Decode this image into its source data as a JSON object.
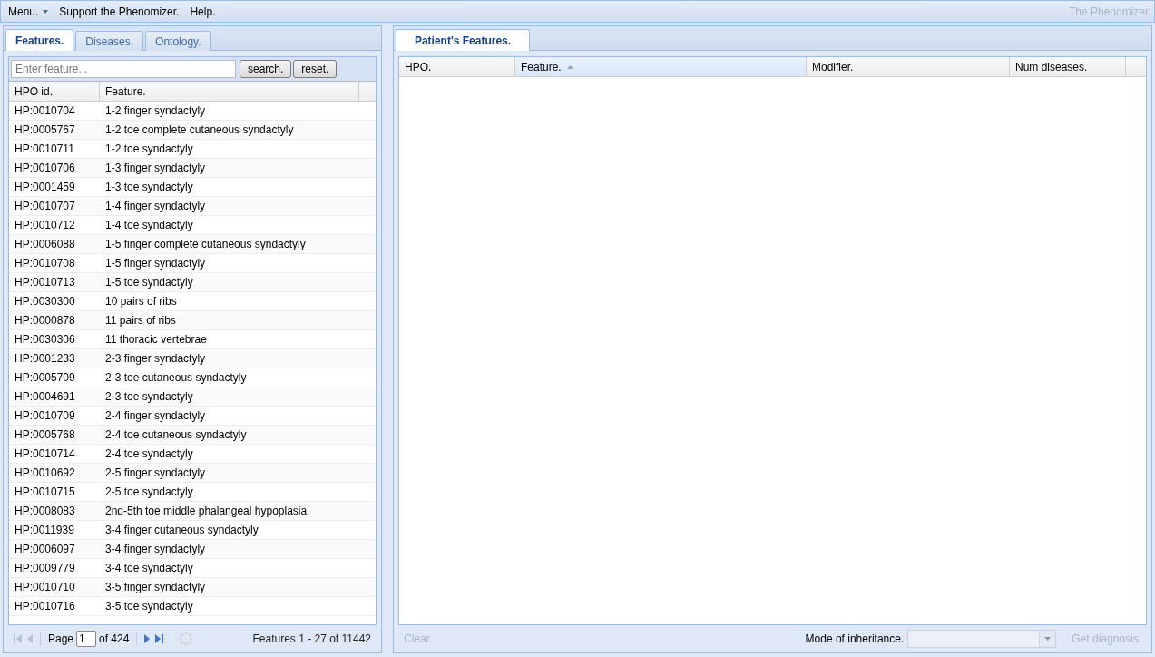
{
  "menu_bar": {
    "items": [
      {
        "label": "Menu.",
        "has_dropdown": true
      },
      {
        "label": "Support the Phenomizer.",
        "has_dropdown": false
      },
      {
        "label": "Help.",
        "has_dropdown": false
      }
    ],
    "app_title": "The Phenomizer"
  },
  "left_panel": {
    "tabs": [
      {
        "label": "Features.",
        "selected": true
      },
      {
        "label": "Diseases.",
        "selected": false
      },
      {
        "label": "Ontology.",
        "selected": false
      }
    ],
    "search": {
      "placeholder": "Enter feature...",
      "buttons": [
        "search.",
        "reset."
      ]
    },
    "table": {
      "columns": [
        {
          "label": "HPO id."
        },
        {
          "label": "Feature."
        }
      ],
      "rows": [
        [
          "HP:0010704",
          "1-2 finger syndactyly"
        ],
        [
          "HP:0005767",
          "1-2 toe complete cutaneous syndactyly"
        ],
        [
          "HP:0010711",
          "1-2 toe syndactyly"
        ],
        [
          "HP:0010706",
          "1-3 finger syndactyly"
        ],
        [
          "HP:0001459",
          "1-3 toe syndactyly"
        ],
        [
          "HP:0010707",
          "1-4 finger syndactyly"
        ],
        [
          "HP:0010712",
          "1-4 toe syndactyly"
        ],
        [
          "HP:0006088",
          "1-5 finger complete cutaneous syndactyly"
        ],
        [
          "HP:0010708",
          "1-5 finger syndactyly"
        ],
        [
          "HP:0010713",
          "1-5 toe syndactyly"
        ],
        [
          "HP:0030300",
          "10 pairs of ribs"
        ],
        [
          "HP:0000878",
          "11 pairs of ribs"
        ],
        [
          "HP:0030306",
          "11 thoracic vertebrae"
        ],
        [
          "HP:0001233",
          "2-3 finger syndactyly"
        ],
        [
          "HP:0005709",
          "2-3 toe cutaneous syndactyly"
        ],
        [
          "HP:0004691",
          "2-3 toe syndactyly"
        ],
        [
          "HP:0010709",
          "2-4 finger syndactyly"
        ],
        [
          "HP:0005768",
          "2-4 toe cutaneous syndactyly"
        ],
        [
          "HP:0010714",
          "2-4 toe syndactyly"
        ],
        [
          "HP:0010692",
          "2-5 finger syndactyly"
        ],
        [
          "HP:0010715",
          "2-5 toe syndactyly"
        ],
        [
          "HP:0008083",
          "2nd-5th toe middle phalangeal hypoplasia"
        ],
        [
          "HP:0011939",
          "3-4 finger cutaneous syndactyly"
        ],
        [
          "HP:0006097",
          "3-4 finger syndactyly"
        ],
        [
          "HP:0009779",
          "3-4 toe syndactyly"
        ],
        [
          "HP:0010710",
          "3-5 finger syndactyly"
        ],
        [
          "HP:0010716",
          "3-5 toe syndactyly"
        ]
      ]
    },
    "pager": {
      "first_disabled": true,
      "prev_disabled": true,
      "next_disabled": false,
      "last_disabled": false,
      "page_label": "Page",
      "page_value": "1",
      "page_total": "of 424",
      "summary": "Features 1 - 27 of 11442"
    }
  },
  "right_panel": {
    "tabs": [
      {
        "label": "Patient's Features.",
        "selected": true
      }
    ],
    "table": {
      "columns": [
        {
          "label": "HPO.",
          "sorted": false
        },
        {
          "label": "Feature.",
          "sorted": true
        },
        {
          "label": "Modifier.",
          "sorted": false
        },
        {
          "label": "Num diseases.",
          "sorted": false
        }
      ]
    },
    "footer": {
      "clear_button": {
        "label": "Clear.",
        "disabled": true
      },
      "mode_label": "Mode of inheritance.",
      "diagnosis_button": {
        "label": "Get diagnosis.",
        "disabled": true
      }
    }
  }
}
